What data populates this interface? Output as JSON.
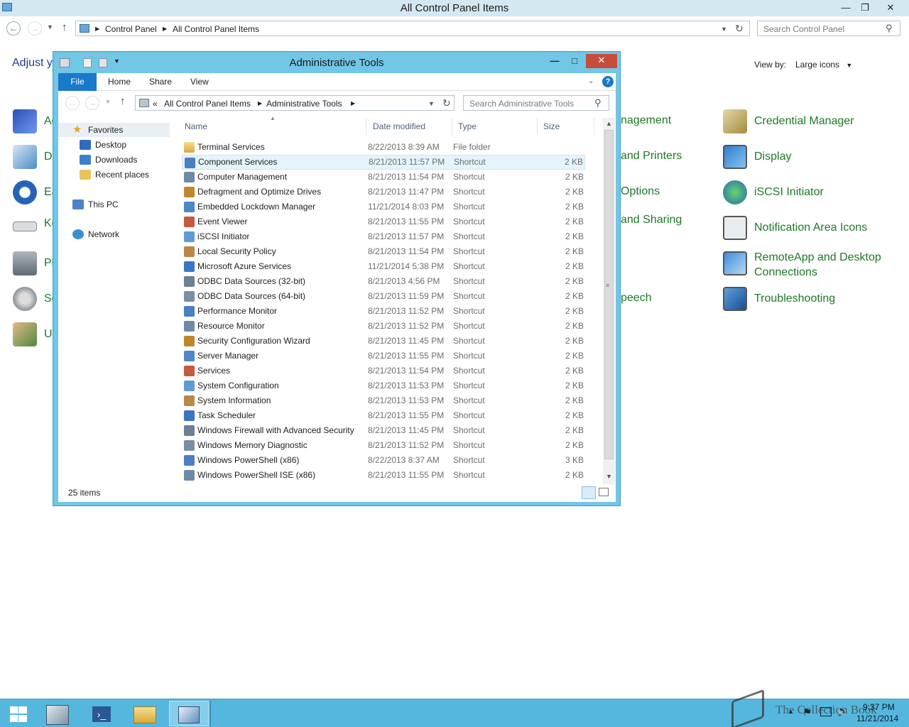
{
  "main_window": {
    "title": "All Control Panel Items",
    "breadcrumb": [
      "Control Panel",
      "All Control Panel Items"
    ],
    "search_placeholder": "Search Control Panel",
    "heading_partial": "Adjust y",
    "view_by_label": "View by:",
    "view_by_value": "Large icons",
    "left_items_partial": [
      "Ac",
      "D",
      "Ea",
      "Ke",
      "Ph",
      "So",
      "U"
    ],
    "middle_items_partial": [
      "nagement",
      "and Printers",
      "Options",
      "and Sharing",
      "peech"
    ],
    "right_items": [
      "Credential Manager",
      "Display",
      "iSCSI Initiator",
      "Notification Area Icons",
      "RemoteApp and Desktop Connections",
      "Troubleshooting"
    ]
  },
  "admin_window": {
    "title": "Administrative Tools",
    "ribbon_tabs": [
      "File",
      "Home",
      "Share",
      "View"
    ],
    "breadcrumb_prefix": "«",
    "breadcrumb": [
      "All Control Panel Items",
      "Administrative Tools"
    ],
    "search_placeholder": "Search Administrative Tools",
    "nav": {
      "favorites": "Favorites",
      "desktop": "Desktop",
      "downloads": "Downloads",
      "recent": "Recent places",
      "this_pc": "This PC",
      "network": "Network"
    },
    "columns": [
      "Name",
      "Date modified",
      "Type",
      "Size"
    ],
    "files": [
      {
        "name": "Terminal Services",
        "date": "8/22/2013 8:39 AM",
        "type": "File folder",
        "size": ""
      },
      {
        "name": "Component Services",
        "date": "8/21/2013 11:57 PM",
        "type": "Shortcut",
        "size": "2 KB"
      },
      {
        "name": "Computer Management",
        "date": "8/21/2013 11:54 PM",
        "type": "Shortcut",
        "size": "2 KB"
      },
      {
        "name": "Defragment and Optimize Drives",
        "date": "8/21/2013 11:47 PM",
        "type": "Shortcut",
        "size": "2 KB"
      },
      {
        "name": "Embedded Lockdown Manager",
        "date": "11/21/2014 8:03 PM",
        "type": "Shortcut",
        "size": "2 KB"
      },
      {
        "name": "Event Viewer",
        "date": "8/21/2013 11:55 PM",
        "type": "Shortcut",
        "size": "2 KB"
      },
      {
        "name": "iSCSI Initiator",
        "date": "8/21/2013 11:57 PM",
        "type": "Shortcut",
        "size": "2 KB"
      },
      {
        "name": "Local Security Policy",
        "date": "8/21/2013 11:54 PM",
        "type": "Shortcut",
        "size": "2 KB"
      },
      {
        "name": "Microsoft Azure Services",
        "date": "11/21/2014 5:38 PM",
        "type": "Shortcut",
        "size": "2 KB"
      },
      {
        "name": "ODBC Data Sources (32-bit)",
        "date": "8/21/2013 4:56 PM",
        "type": "Shortcut",
        "size": "2 KB"
      },
      {
        "name": "ODBC Data Sources (64-bit)",
        "date": "8/21/2013 11:59 PM",
        "type": "Shortcut",
        "size": "2 KB"
      },
      {
        "name": "Performance Monitor",
        "date": "8/21/2013 11:52 PM",
        "type": "Shortcut",
        "size": "2 KB"
      },
      {
        "name": "Resource Monitor",
        "date": "8/21/2013 11:52 PM",
        "type": "Shortcut",
        "size": "2 KB"
      },
      {
        "name": "Security Configuration Wizard",
        "date": "8/21/2013 11:45 PM",
        "type": "Shortcut",
        "size": "2 KB"
      },
      {
        "name": "Server Manager",
        "date": "8/21/2013 11:55 PM",
        "type": "Shortcut",
        "size": "2 KB"
      },
      {
        "name": "Services",
        "date": "8/21/2013 11:54 PM",
        "type": "Shortcut",
        "size": "2 KB"
      },
      {
        "name": "System Configuration",
        "date": "8/21/2013 11:53 PM",
        "type": "Shortcut",
        "size": "2 KB"
      },
      {
        "name": "System Information",
        "date": "8/21/2013 11:53 PM",
        "type": "Shortcut",
        "size": "2 KB"
      },
      {
        "name": "Task Scheduler",
        "date": "8/21/2013 11:55 PM",
        "type": "Shortcut",
        "size": "2 KB"
      },
      {
        "name": "Windows Firewall with Advanced Security",
        "date": "8/21/2013 11:45 PM",
        "type": "Shortcut",
        "size": "2 KB"
      },
      {
        "name": "Windows Memory Diagnostic",
        "date": "8/21/2013 11:52 PM",
        "type": "Shortcut",
        "size": "2 KB"
      },
      {
        "name": "Windows PowerShell (x86)",
        "date": "8/22/2013 8:37 AM",
        "type": "Shortcut",
        "size": "3 KB"
      },
      {
        "name": "Windows PowerShell ISE (x86)",
        "date": "8/21/2013 11:55 PM",
        "type": "Shortcut",
        "size": "2 KB"
      }
    ],
    "status_count": "25 items"
  },
  "taskbar": {
    "time": "9:37 PM",
    "date": "11/21/2014",
    "watermark": "The Collection Book"
  },
  "colors": {
    "link_green": "#1c7a25",
    "window_frame": "#72c6e6",
    "taskbar": "#56b7de",
    "file_tab": "#1979ca",
    "selected_row": "#e5f3fb"
  }
}
